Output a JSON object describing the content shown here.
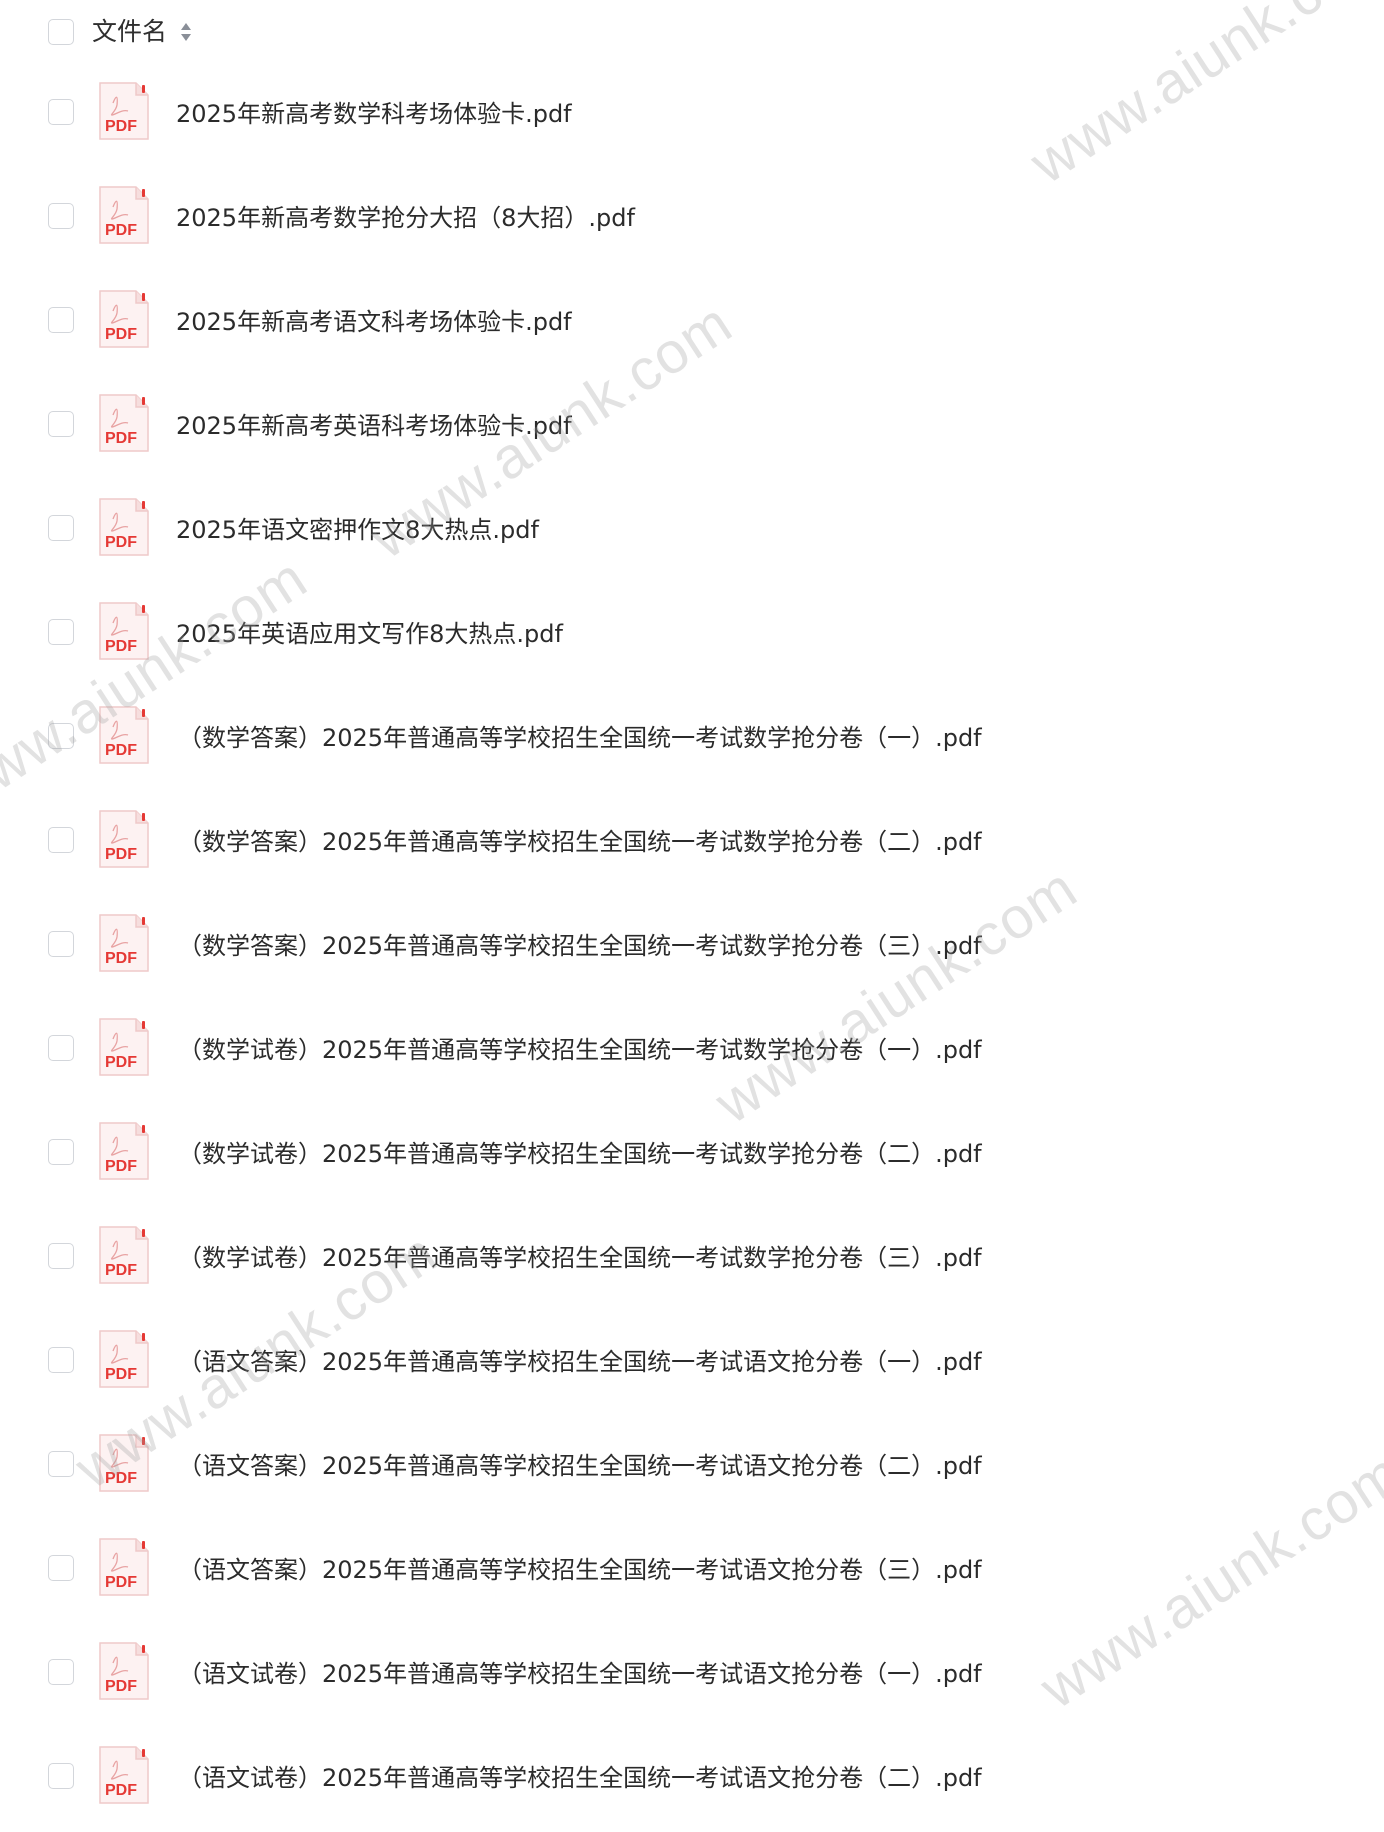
{
  "header": {
    "column_label": "文件名",
    "select_all_checked": false,
    "sort_icon": "sort-icon"
  },
  "files": [
    {
      "name": "2025年新高考数学科考场体验卡.pdf",
      "icon": "pdf-icon",
      "icon_label": "PDF",
      "checked": false
    },
    {
      "name": "2025年新高考数学抢分大招（8大招）.pdf",
      "icon": "pdf-icon",
      "icon_label": "PDF",
      "checked": false
    },
    {
      "name": "2025年新高考语文科考场体验卡.pdf",
      "icon": "pdf-icon",
      "icon_label": "PDF",
      "checked": false
    },
    {
      "name": "2025年新高考英语科考场体验卡.pdf",
      "icon": "pdf-icon",
      "icon_label": "PDF",
      "checked": false
    },
    {
      "name": "2025年语文密押作文8大热点.pdf",
      "icon": "pdf-icon",
      "icon_label": "PDF",
      "checked": false
    },
    {
      "name": "2025年英语应用文写作8大热点.pdf",
      "icon": "pdf-icon",
      "icon_label": "PDF",
      "checked": false
    },
    {
      "name": "（数学答案）2025年普通高等学校招生全国统一考试数学抢分卷（一）.pdf",
      "icon": "pdf-icon",
      "icon_label": "PDF",
      "checked": false
    },
    {
      "name": "（数学答案）2025年普通高等学校招生全国统一考试数学抢分卷（二）.pdf",
      "icon": "pdf-icon",
      "icon_label": "PDF",
      "checked": false
    },
    {
      "name": "（数学答案）2025年普通高等学校招生全国统一考试数学抢分卷（三）.pdf",
      "icon": "pdf-icon",
      "icon_label": "PDF",
      "checked": false
    },
    {
      "name": "（数学试卷）2025年普通高等学校招生全国统一考试数学抢分卷（一）.pdf",
      "icon": "pdf-icon",
      "icon_label": "PDF",
      "checked": false
    },
    {
      "name": "（数学试卷）2025年普通高等学校招生全国统一考试数学抢分卷（二）.pdf",
      "icon": "pdf-icon",
      "icon_label": "PDF",
      "checked": false
    },
    {
      "name": "（数学试卷）2025年普通高等学校招生全国统一考试数学抢分卷（三）.pdf",
      "icon": "pdf-icon",
      "icon_label": "PDF",
      "checked": false
    },
    {
      "name": "（语文答案）2025年普通高等学校招生全国统一考试语文抢分卷（一）.pdf",
      "icon": "pdf-icon",
      "icon_label": "PDF",
      "checked": false
    },
    {
      "name": "（语文答案）2025年普通高等学校招生全国统一考试语文抢分卷（二）.pdf",
      "icon": "pdf-icon",
      "icon_label": "PDF",
      "checked": false
    },
    {
      "name": "（语文答案）2025年普通高等学校招生全国统一考试语文抢分卷（三）.pdf",
      "icon": "pdf-icon",
      "icon_label": "PDF",
      "checked": false
    },
    {
      "name": "（语文试卷）2025年普通高等学校招生全国统一考试语文抢分卷（一）.pdf",
      "icon": "pdf-icon",
      "icon_label": "PDF",
      "checked": false
    },
    {
      "name": "（语文试卷）2025年普通高等学校招生全国统一考试语文抢分卷（二）.pdf",
      "icon": "pdf-icon",
      "icon_label": "PDF",
      "checked": false
    }
  ],
  "watermark": {
    "text": "www.aiunk.com",
    "color": "#a0a0a0"
  },
  "colors": {
    "pdf_red": "#e53935",
    "checkbox_border": "#d3d6db",
    "text": "#2b2b2b",
    "sort_icon": "#8a8f98"
  }
}
